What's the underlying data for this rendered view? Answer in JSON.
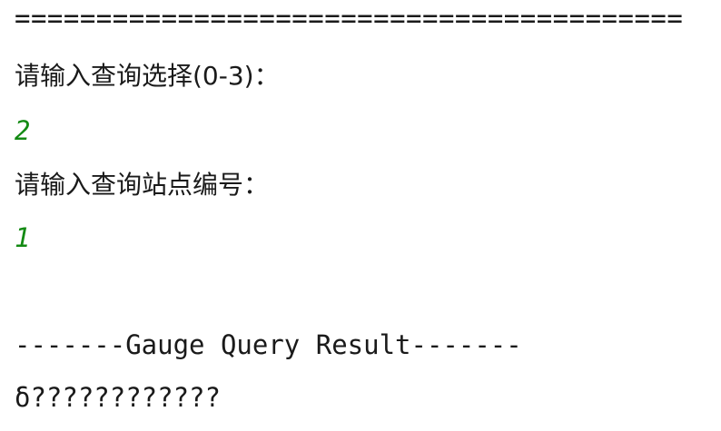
{
  "console": {
    "separator": "=========================================",
    "prompt_query_choice": "请输入查询选择(0-3)：",
    "input_query_choice": "2",
    "prompt_station_number": "请输入查询站点编号：",
    "input_station_number": "1",
    "result_header": "-------Gauge Query Result-------",
    "result_text": "δ????????????"
  },
  "colors": {
    "text": "#1a1a1a",
    "user_input": "#138a13",
    "background": "#ffffff"
  }
}
